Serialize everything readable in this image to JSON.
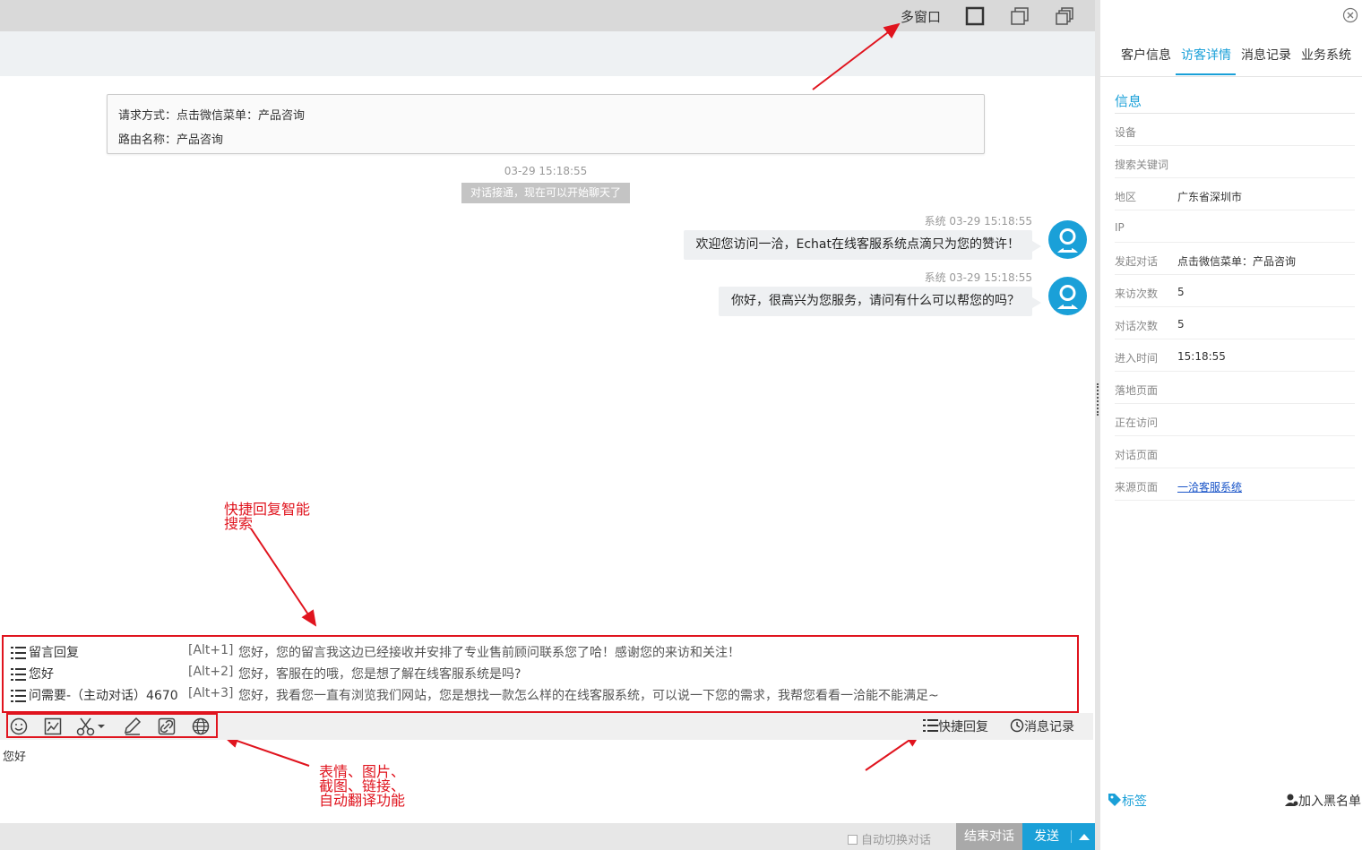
{
  "topbar": {
    "multi_window_label": "多窗口"
  },
  "request_info": {
    "line1": "请求方式：点击微信菜单：产品咨询",
    "line2": "路由名称：产品咨询"
  },
  "chat": {
    "timestamp": "03-29 15:18:55",
    "connected_notice": "对话接通，现在可以开始聊天了",
    "messages": [
      {
        "meta": "系统  03-29 15:18:55",
        "text": "欢迎您访问一洽，Echat在线客服系统点滴只为您的赞许！"
      },
      {
        "meta": "系统  03-29 15:18:55",
        "text": "你好，很高兴为您服务，请问有什么可以帮您的吗？"
      }
    ]
  },
  "annotations": {
    "quick_reply_search_1": "快捷回复智能",
    "quick_reply_search_2": "搜索",
    "toolbar_1": "表情、图片、",
    "toolbar_2": "截图、链接、",
    "toolbar_3": "自动翻译功能"
  },
  "quick_replies": [
    {
      "name": "留言回复",
      "key": "[Alt+1]",
      "text": "您好，您的留言我这边已经接收并安排了专业售前顾问联系您了哈！感谢您的来访和关注！"
    },
    {
      "name": "您好",
      "key": "[Alt+2]",
      "text": "您好，客服在的哦，您是想了解在线客服系统是吗?"
    },
    {
      "name": "问需要-（主动对话）4670",
      "key": "[Alt+3]",
      "text": "您好，我看您一直有浏览我们网站，您是想找一款怎么样的在线客服系统，可以说一下您的需求，我帮您看看一洽能不能满足~"
    }
  ],
  "toolbar": {
    "icons": [
      "emoji-icon",
      "image-icon",
      "scissors-icon",
      "edit-icon",
      "link-icon",
      "globe-icon"
    ],
    "quick_reply_label": "快捷回复",
    "history_label": "消息记录"
  },
  "input": {
    "value": "您好"
  },
  "bottom": {
    "auto_switch_label": "自动切换对话",
    "end_label": "结束对话",
    "send_label": "发送"
  },
  "right_panel": {
    "tabs": [
      "客户信息",
      "访客详情",
      "消息记录",
      "业务系统"
    ],
    "active_tab": "访客详情",
    "info_title": "信息",
    "rows": [
      {
        "label": "设备",
        "value": ""
      },
      {
        "label": "搜索关键词",
        "value": ""
      },
      {
        "label": "地区",
        "value": "广东省深圳市"
      },
      {
        "label": "IP",
        "value": ""
      },
      {
        "label": "发起对话",
        "value": "点击微信菜单：产品咨询"
      },
      {
        "label": "来访次数",
        "value": "5"
      },
      {
        "label": "对话次数",
        "value": "5"
      },
      {
        "label": "进入时间",
        "value": "15:18:55"
      },
      {
        "label": "落地页面",
        "value": ""
      },
      {
        "label": "正在访问",
        "value": ""
      },
      {
        "label": "对话页面",
        "value": ""
      },
      {
        "label": "来源页面",
        "value": "一洽客服系统"
      }
    ],
    "tags_label": "标签",
    "blacklist_label": "加入黑名单"
  },
  "colors": {
    "accent": "#1aa0d8",
    "annotation": "#e0141e",
    "link": "#1a55c8"
  }
}
